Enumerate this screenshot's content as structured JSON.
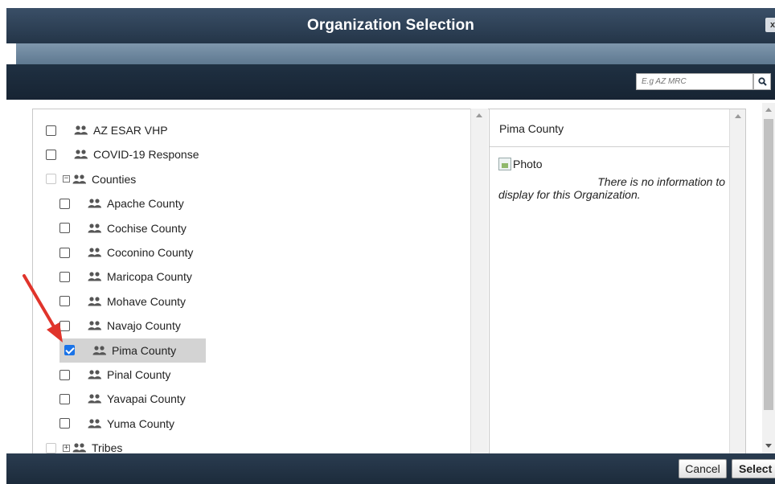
{
  "dialog": {
    "title": "Organization Selection",
    "close_label": "x"
  },
  "search": {
    "placeholder": "E.g AZ MRC",
    "icon": "search-icon"
  },
  "tree": {
    "items": [
      {
        "label": "AZ ESAR VHP",
        "checked": false,
        "level": 0
      },
      {
        "label": "COVID-19 Response",
        "checked": false,
        "level": 0
      },
      {
        "label": "Counties",
        "checked": false,
        "level": 0,
        "expander": "⊟",
        "disabled": true
      },
      {
        "label": "Apache County",
        "checked": false,
        "level": 1
      },
      {
        "label": "Cochise County",
        "checked": false,
        "level": 1
      },
      {
        "label": "Coconino County",
        "checked": false,
        "level": 1
      },
      {
        "label": "Maricopa County",
        "checked": false,
        "level": 1
      },
      {
        "label": "Mohave County",
        "checked": false,
        "level": 1
      },
      {
        "label": "Navajo County",
        "checked": false,
        "level": 1
      },
      {
        "label": "Pima County",
        "checked": true,
        "level": 1,
        "selected": true
      },
      {
        "label": "Pinal County",
        "checked": false,
        "level": 1
      },
      {
        "label": "Yavapai County",
        "checked": false,
        "level": 1
      },
      {
        "label": "Yuma County",
        "checked": false,
        "level": 1
      },
      {
        "label": "Tribes",
        "checked": false,
        "level": 0,
        "expander": "⊞",
        "disabled": true
      }
    ],
    "item_icon": "group-icon"
  },
  "info": {
    "title": "Pima County",
    "photo_alt": "Photo",
    "message_line1": "There is no information to",
    "message_line2": "display for this Organization."
  },
  "footer": {
    "cancel_label": "Cancel",
    "select_label": "Select"
  },
  "colors": {
    "titlebar": "#2f4258",
    "subbar": "#6f889f",
    "searchbar": "#1c2b3c",
    "selected_row": "#d3d3d3",
    "check_blue": "#1a73e8",
    "annotation_arrow": "#e0342b"
  }
}
